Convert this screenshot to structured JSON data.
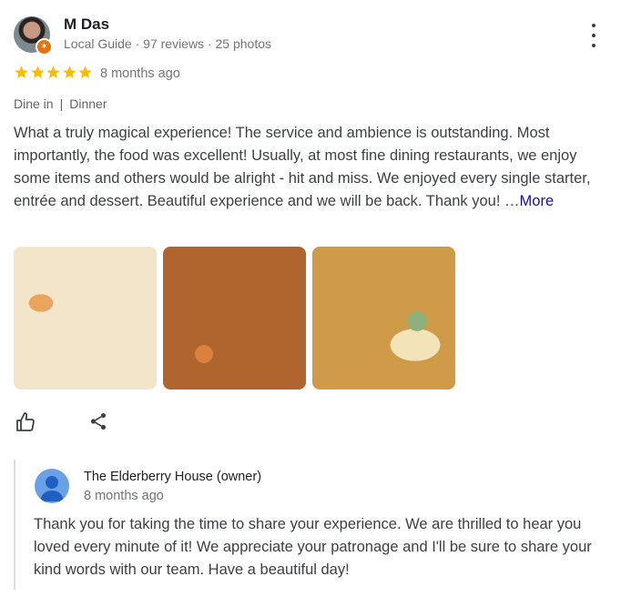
{
  "reviewer": {
    "name": "M Das",
    "meta": "Local Guide · 97 reviews · 25 photos"
  },
  "rating": {
    "stars": 5,
    "max": 5,
    "time_ago": "8 months ago"
  },
  "tags": {
    "service": "Dine in",
    "separator": "|",
    "meal": "Dinner"
  },
  "review": {
    "text": "What a truly magical experience! The service and ambience is outstanding. Most importantly, the food was excellent! Usually, at most fine dining restaurants, we enjoy some items and others would be alright - hit and miss. We enjoyed every single starter, entrée and dessert. Beautiful experience and we will be back. Thank you! …",
    "more_label": "More"
  },
  "actions": {
    "like_icon": "thumbs-up-icon",
    "share_icon": "share-icon"
  },
  "owner_reply": {
    "name": "The Elderberry House (owner)",
    "time_ago": "8 months ago",
    "text": "Thank you for taking the time to share your experience. We are thrilled to hear you loved every minute of it! We appreciate your patronage and I'll be sure to share your kind words with our team. Have a beautiful day!"
  },
  "colors": {
    "star": "#fbbc04",
    "link": "#1a0dab",
    "guide_badge": "#e8710a"
  }
}
